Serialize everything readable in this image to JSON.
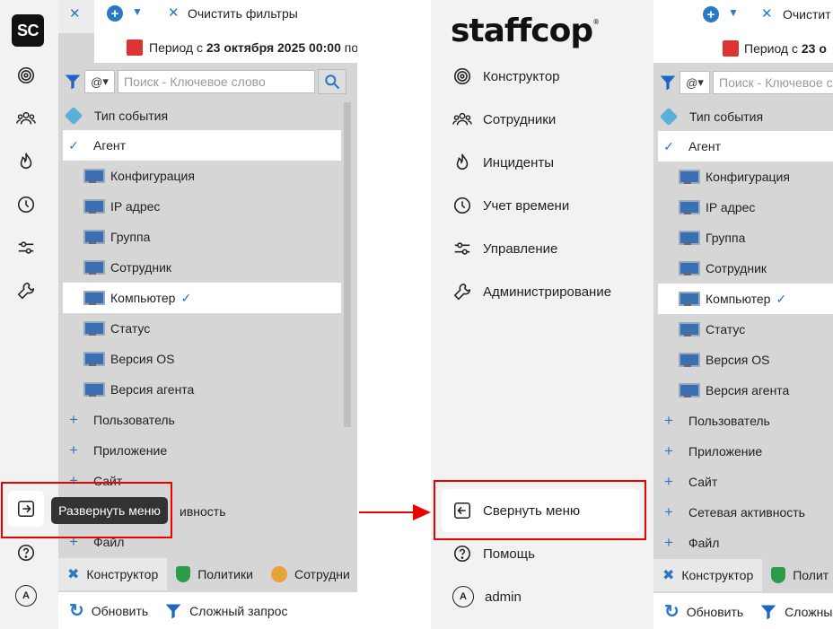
{
  "left": {
    "logo": "SC",
    "top_clear_filters": "Очистить фильтры",
    "period_prefix": "Период с ",
    "period_date": "23 октября 2025 00:00",
    "period_suffix": " по",
    "search_mode": "@",
    "search_placeholder": "Поиск - Ключевое слово",
    "tree": {
      "event_type": "Тип события",
      "agent": "Агент",
      "agent_items": [
        "Конфигурация",
        "IP адрес",
        "Группа",
        "Сотрудник",
        "Компьютер",
        "Статус",
        "Версия OS",
        "Версия агента"
      ],
      "groups": [
        "Пользователь",
        "Приложение",
        "Сайт",
        "Сетевая активность",
        "Файл"
      ],
      "groups_partial": [
        "Пользователь",
        "Приложение",
        "Сайт",
        "ивность",
        "Файл"
      ]
    },
    "tooltip": "Развернуть меню",
    "bottom_tabs": [
      "Конструктор",
      "Политики",
      "Сотрудни"
    ],
    "footer": {
      "refresh": "Обновить",
      "complex_query": "Сложный запрос"
    }
  },
  "sidebar": {
    "logo": "staffcop",
    "logo_mark": "®",
    "items": [
      "Конструктор",
      "Сотрудники",
      "Инциденты",
      "Учет времени",
      "Управление",
      "Администрирование"
    ],
    "collapse": "Свернуть меню",
    "help": "Помощь",
    "user_initial": "A",
    "user": "admin"
  },
  "right": {
    "top_clear_filters": "Очистит",
    "period_prefix": "Период с ",
    "period_date": "23 о",
    "search_placeholder": "Поиск - Ключевое сл",
    "bottom_tabs": [
      "Конструктор",
      "Полит"
    ],
    "footer": {
      "refresh": "Обновить",
      "complex_query": "Сложный"
    }
  },
  "colors": {
    "accent": "#2a78c8",
    "highlight": "#e00000",
    "rail": "#f2f2f2",
    "panel": "#d6d6d6"
  }
}
